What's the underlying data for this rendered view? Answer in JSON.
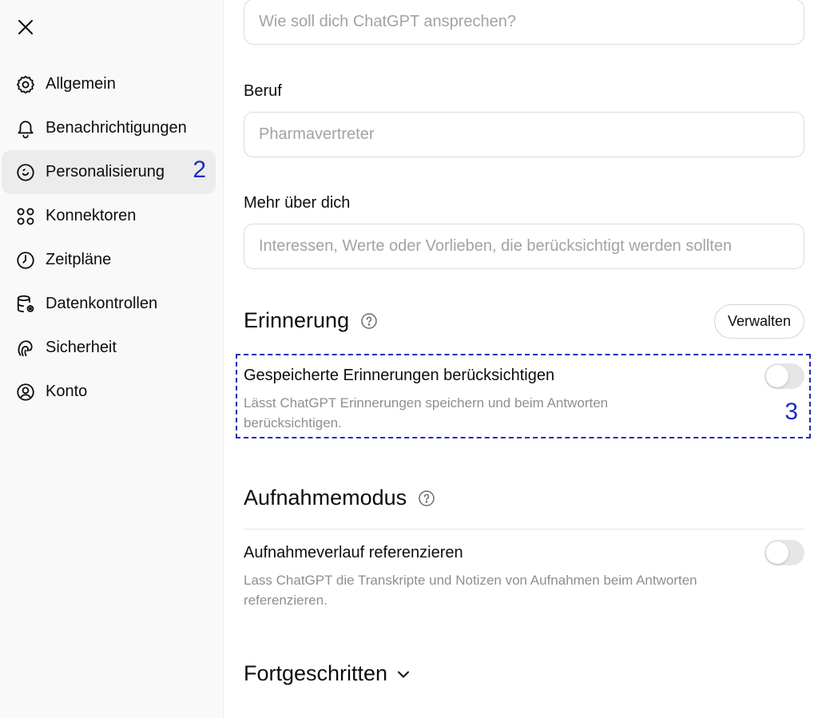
{
  "sidebar": {
    "close_icon": "close-icon",
    "items": [
      {
        "label": "Allgemein",
        "icon": "gear-icon"
      },
      {
        "label": "Benachrichtigungen",
        "icon": "bell-icon"
      },
      {
        "label": "Personalisierung",
        "icon": "personalization-icon",
        "active": true,
        "badge": "2"
      },
      {
        "label": "Konnektoren",
        "icon": "connectors-icon"
      },
      {
        "label": "Zeitpläne",
        "icon": "clock-icon"
      },
      {
        "label": "Datenkontrollen",
        "icon": "database-icon"
      },
      {
        "label": "Sicherheit",
        "icon": "fingerprint-icon"
      },
      {
        "label": "Konto",
        "icon": "account-icon"
      }
    ]
  },
  "main": {
    "nickname": {
      "placeholder": "Wie soll dich ChatGPT ansprechen?",
      "value": ""
    },
    "occupation": {
      "label": "Beruf",
      "placeholder": "Pharmavertreter",
      "value": ""
    },
    "more_about": {
      "label": "Mehr über dich",
      "placeholder": "Interessen, Werte oder Vorlieben, die berücksichtigt werden sollten",
      "value": ""
    },
    "memory": {
      "title": "Erinnerung",
      "manage_label": "Verwalten",
      "saved_memories": {
        "title": "Gespeicherte Erinnerungen berücksichtigen",
        "description": "Lässt ChatGPT Erinnerungen speichern und beim Antworten berücksichtigen.",
        "enabled": false
      },
      "annotation": "3"
    },
    "recording": {
      "title": "Aufnahmemodus",
      "history": {
        "title": "Aufnahmeverlauf referenzieren",
        "description": "Lass ChatGPT die Transkripte und Notizen von Aufnahmen beim Antworten referenzieren.",
        "enabled": false
      }
    },
    "advanced_label": "Fortgeschritten"
  },
  "colors": {
    "annotation": "#1a2fb8",
    "sidebar_bg": "#f9f9f9",
    "active_bg": "#ececec",
    "muted_text": "#8f8f8f"
  }
}
